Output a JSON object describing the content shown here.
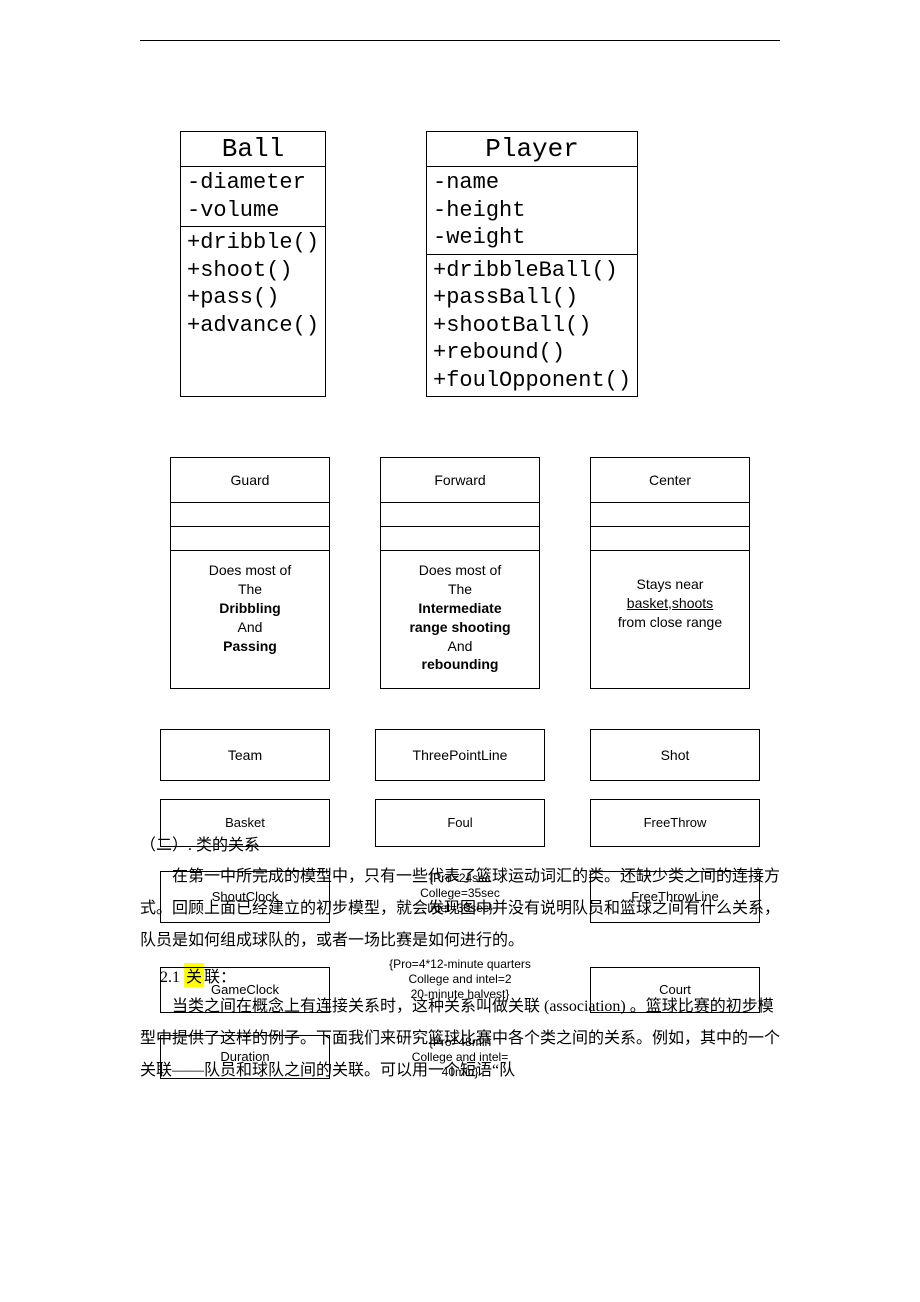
{
  "uml": {
    "ball": {
      "name": "Ball",
      "attrs": [
        "-diameter",
        "-volume"
      ],
      "ops": [
        "+dribble()",
        "+shoot()",
        "+pass()",
        "+advance()"
      ]
    },
    "player": {
      "name": "Player",
      "attrs": [
        "-name",
        "-height",
        "-weight"
      ],
      "ops": [
        "+dribbleBall()",
        "+passBall()",
        "+shootBall()",
        "+rebound()",
        "+foulOpponent()"
      ]
    }
  },
  "roles": {
    "guard": {
      "name": "Guard",
      "desc_pre": "Does most of",
      "desc_the": "The",
      "b1": "Dribbling",
      "mid": "And",
      "b2": "Passing"
    },
    "forward": {
      "name": "Forward",
      "desc_pre": "Does most of",
      "desc_the": "The",
      "b1": "Intermediate",
      "b1b": "range shooting",
      "mid": "And",
      "b2": "rebounding"
    },
    "center": {
      "name": "Center",
      "l1": "Stays near",
      "l2": "basket,shoots",
      "l3": "from close range"
    }
  },
  "label_rows": {
    "r1": [
      "Team",
      "ThreePointLine",
      "Shot"
    ],
    "r2": [
      "Basket",
      "Foul",
      "FreeThrow"
    ]
  },
  "overlays": {
    "r3": {
      "a": {
        "title": "ShoutClock",
        "note": "{Pro=24sec\nCollege=35sec\nIntel=30sec}"
      },
      "b": {
        "title": "",
        "note": ""
      },
      "c": {
        "title": "FreeThrowLine",
        "note": ""
      }
    },
    "r4": {
      "a": {
        "title": "GameClock",
        "note": "{Pro=4*12-minute quarters\nCollege and intel=2\n20-minute halvest}"
      },
      "c": {
        "title": "Court",
        "note": ""
      }
    },
    "r5": {
      "a": {
        "title": "Duration",
        "note": "{Pro=48min\nCollege and intel=\n40min}"
      }
    }
  },
  "text": {
    "sec_heading": "（二）. 类的关系",
    "p1": "在第一中所完成的模型中，只有一些代表了篮球运动词汇的类。还缺少类之间的连接方式。回顾上面已经建立的初步模型，就会发现图中并没有说明队员和篮球之间有什么关系，队员是如何组成球队的，或者一场比赛是如何进行的。",
    "sub_heading_pre": "2.1",
    "sub_heading_hl": "关",
    "sub_heading_post": "联：",
    "p2": "当类之间在概念上有连接关系时，这种关系叫做关联 (association) 。篮球比赛的初步模型中提供了这样的例子。下面我们来研究篮球比赛中各个类之间的关系。例如，其中的一个关联——队员和球队之间的关联。可以用一个短语“队"
  }
}
